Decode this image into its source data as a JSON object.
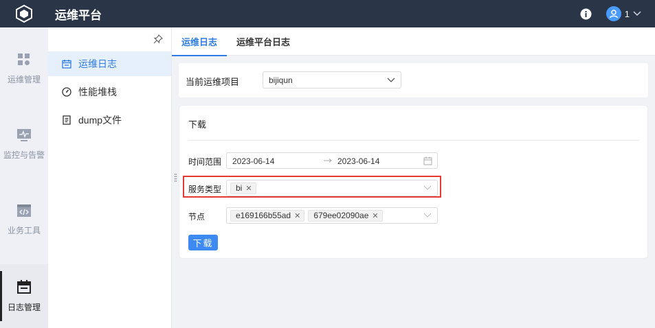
{
  "app": {
    "title": "运维平台",
    "user_name": "1"
  },
  "rail": [
    {
      "label": "运维管理",
      "icon": "dashboard-grid-icon"
    },
    {
      "label": "监控与告警",
      "icon": "monitor-icon"
    },
    {
      "label": "业务工具",
      "icon": "code-window-icon"
    },
    {
      "label": "日志管理",
      "icon": "calendar-log-icon",
      "active": true
    }
  ],
  "submenu": [
    {
      "label": "运维日志",
      "icon": "calendar-icon",
      "active": true
    },
    {
      "label": "性能堆栈",
      "icon": "gauge-icon"
    },
    {
      "label": "dump文件",
      "icon": "file-icon"
    }
  ],
  "tabs": [
    {
      "label": "运维日志",
      "active": true
    },
    {
      "label": "运维平台日志"
    }
  ],
  "project": {
    "label": "当前运维项目",
    "value": "bijiqun"
  },
  "download": {
    "title": "下载",
    "time_range_label": "时间范围",
    "start_date": "2023-06-14",
    "end_date": "2023-06-14",
    "service_label": "服务类型",
    "service_tags": [
      "bi"
    ],
    "node_label": "节点",
    "node_tags": [
      "e169166b55ad",
      "679ee02090ae"
    ],
    "button_label": "下载"
  },
  "colors": {
    "topbar": "#2a3547",
    "accent": "#2d7be5",
    "highlight": "#e53935"
  }
}
